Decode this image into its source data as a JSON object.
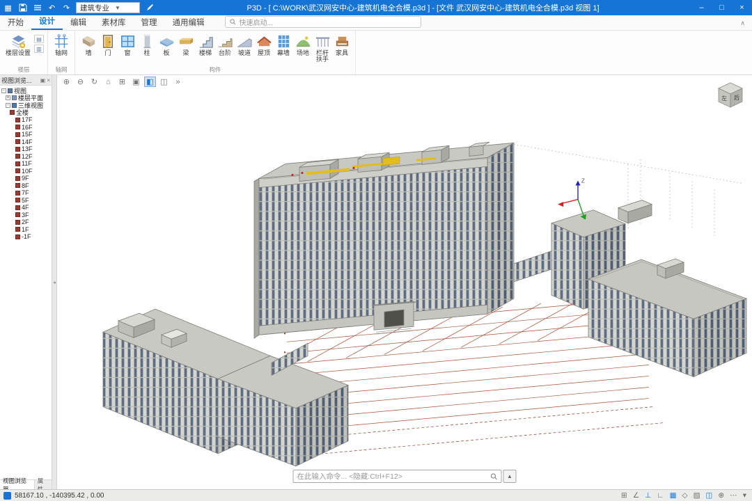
{
  "titlebar": {
    "app_title": "P3D - [ C:\\WORK\\武汉网安中心-建筑机电全合模.p3d ] - [文件 武汉网安中心-建筑机电全合模.p3d 视图 1]",
    "profile_selector": "建筑专业",
    "window": {
      "minimize": "–",
      "maximize": "□",
      "close": "×"
    }
  },
  "ribbon": {
    "tabs": [
      {
        "label": "开始",
        "active": false
      },
      {
        "label": "设计",
        "active": true
      },
      {
        "label": "编辑",
        "active": false
      },
      {
        "label": "素材库",
        "active": false
      },
      {
        "label": "管理",
        "active": false
      },
      {
        "label": "通用编辑",
        "active": false
      }
    ],
    "quick_search_placeholder": "快速启动...",
    "groups": {
      "floor": "楼层",
      "grid": "轴网",
      "component": "构件"
    },
    "tools": {
      "floor_settings": "楼层设置",
      "axis_grid": "轴网",
      "wall": "墙",
      "door": "门",
      "window": "窗",
      "column": "柱",
      "slab": "板",
      "beam": "梁",
      "stair": "楼梯",
      "step": "台阶",
      "ramp": "坡道",
      "roof": "屋顶",
      "curtain_wall": "幕墙",
      "site": "场地",
      "railing": "栏杆扶手",
      "furniture": "家具"
    }
  },
  "view_toolbar": {
    "icons": [
      {
        "name": "pan-icon",
        "glyph": "⊕",
        "active": false
      },
      {
        "name": "zoom-icon",
        "glyph": "⊖",
        "active": false
      },
      {
        "name": "orbit-icon",
        "glyph": "↻",
        "active": false
      },
      {
        "name": "home-view-icon",
        "glyph": "⌂",
        "active": false
      },
      {
        "name": "view-box-icon",
        "glyph": "⊞",
        "active": false
      },
      {
        "name": "shaded-view-icon",
        "glyph": "▣",
        "active": false
      },
      {
        "name": "realistic-view-icon",
        "glyph": "◧",
        "active": true
      },
      {
        "name": "wireframe-view-icon",
        "glyph": "◫",
        "active": false
      },
      {
        "name": "more-view-tools-icon",
        "glyph": "»",
        "active": false
      }
    ]
  },
  "left_panel": {
    "title": "视图浏览...",
    "tree": {
      "root": "视图",
      "floor_plan": "楼层平面",
      "three_d": "三维视图",
      "whole_building": "全楼",
      "floors": [
        "17F",
        "16F",
        "15F",
        "14F",
        "13F",
        "12F",
        "11F",
        "10F",
        "9F",
        "8F",
        "7F",
        "5F",
        "4F",
        "3F",
        "2F",
        "1F",
        "-1F"
      ]
    },
    "bottom_tabs": [
      "视图浏览器",
      "属性"
    ]
  },
  "viewport": {
    "view_cube": {
      "left": "左",
      "back": "后"
    },
    "axis_label": "Z",
    "command_bar": {
      "placeholder": "在此输入命令... <隐藏:Ctrl+F12>"
    }
  },
  "statusbar": {
    "coordinates": "58167.10 , -140395.42 , 0.00",
    "icons": [
      {
        "name": "select-filter-icon",
        "glyph": "⊞",
        "active": false
      },
      {
        "name": "polar-track-icon",
        "glyph": "∠",
        "active": false
      },
      {
        "name": "object-snap-icon",
        "glyph": "⊥",
        "active": true
      },
      {
        "name": "ortho-icon",
        "glyph": "∟",
        "active": false
      },
      {
        "name": "grid-display-icon",
        "glyph": "▦",
        "active": true
      },
      {
        "name": "dynamic-input-icon",
        "glyph": "◇",
        "active": false
      },
      {
        "name": "hatch-display-icon",
        "glyph": "▧",
        "active": false
      },
      {
        "name": "annotation-icon",
        "glyph": "◫",
        "active": true
      },
      {
        "name": "workspace-icon",
        "glyph": "⊕",
        "active": false
      },
      {
        "name": "more-status-icon",
        "glyph": "⋯",
        "active": false
      },
      {
        "name": "status-caret-icon",
        "glyph": "▾",
        "active": false
      }
    ]
  },
  "colors": {
    "titlebar_blue": "#1574d4",
    "accent_blue": "#1574d4",
    "facade_gray": "#d6d6d1",
    "window_band": "#5e6d82",
    "grid_red": "#a84e3a",
    "crane_yellow": "#e2bd1c"
  }
}
